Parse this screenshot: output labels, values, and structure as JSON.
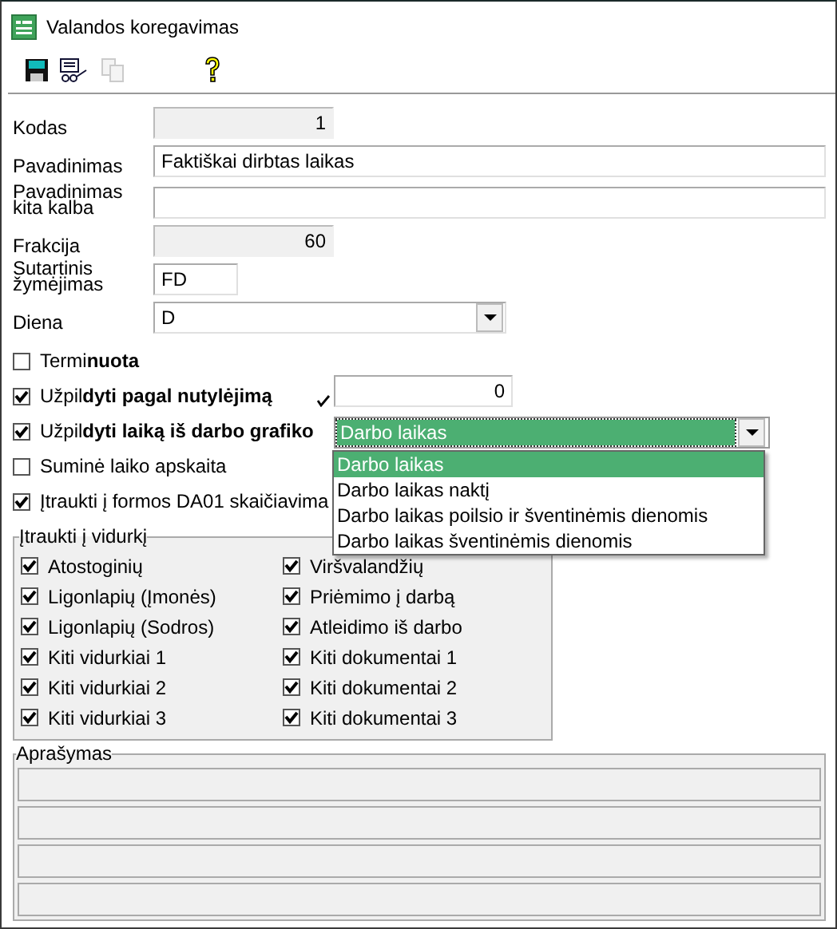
{
  "window": {
    "title": "Valandos koregavimas"
  },
  "toolbar": [
    {
      "kind": "save",
      "disabled": false
    },
    {
      "kind": "preview",
      "disabled": false
    },
    {
      "kind": "copy",
      "disabled": true
    },
    {
      "kind": "help",
      "disabled": false
    }
  ],
  "fields": [
    {
      "label": "Kodas",
      "value": "1",
      "kind": "readonly"
    },
    {
      "label": "Pavadinimas",
      "value": "Faktiškai dirbtas laikas",
      "kind": "text"
    },
    {
      "label": "Pavadinimas kita kalba",
      "kind": "text"
    },
    {
      "label": "Frakcija",
      "value": "60",
      "kind": "readonly"
    },
    {
      "label": "Sutartinis žymėjimas",
      "value": "FD",
      "kind": "short"
    },
    {
      "label": "Diena",
      "value": "D",
      "kind": "select"
    }
  ],
  "options": [
    {
      "label": "Termi**nuota**",
      "checked": false
    },
    {
      "label": "Užpil**dyti pagal nutylėjimą**",
      "checked": true,
      "kind": "default"
    },
    {
      "label": "Užpil**dyti laiką iš darbo grafiko**",
      "checked": true,
      "kind": "schedule"
    },
    {
      "label": "Suminė laiko apskaita",
      "checked": false
    },
    {
      "label": "Įtraukti į formos DA01 skaičiavima",
      "checked": true
    }
  ],
  "default_value": {
    "value": "0"
  },
  "schedule_select": {
    "value": "Darbo laikas",
    "expanded": true,
    "options": [
      {
        "label": "Darbo laikas",
        "selected": true
      },
      {
        "label": "Darbo laikas naktį",
        "selected": false
      },
      {
        "label": "Darbo laikas poilsio ir šventinėmis dienomis",
        "selected": false
      },
      {
        "label": "Darbo laikas šventinėmis dienomis",
        "selected": false
      }
    ]
  },
  "averages": {
    "title": "Įtraukti į vidurkį",
    "columns": [
      [
        {
          "label": "Atostoginių",
          "checked": true
        },
        {
          "label": "Ligonlapių (Įmonės)",
          "checked": true
        },
        {
          "label": "Ligonlapių (Sodros)",
          "checked": true
        },
        {
          "label": "Kiti vidurkiai 1",
          "checked": true
        },
        {
          "label": "Kiti vidurkiai 2",
          "checked": true
        },
        {
          "label": "Kiti vidurkiai 3",
          "checked": true
        }
      ],
      [
        {
          "label": "Viršvalandžių",
          "checked": true
        },
        {
          "label": "Priėmimo į darbą",
          "checked": true
        },
        {
          "label": "Atleidimo iš darbo",
          "checked": true
        },
        {
          "label": "Kiti dokumentai 1",
          "checked": true
        },
        {
          "label": "Kiti dokumentai 2",
          "checked": true
        },
        {
          "label": "Kiti dokumentai 3",
          "checked": true
        }
      ]
    ]
  },
  "description": {
    "title": "Aprašymas"
  }
}
